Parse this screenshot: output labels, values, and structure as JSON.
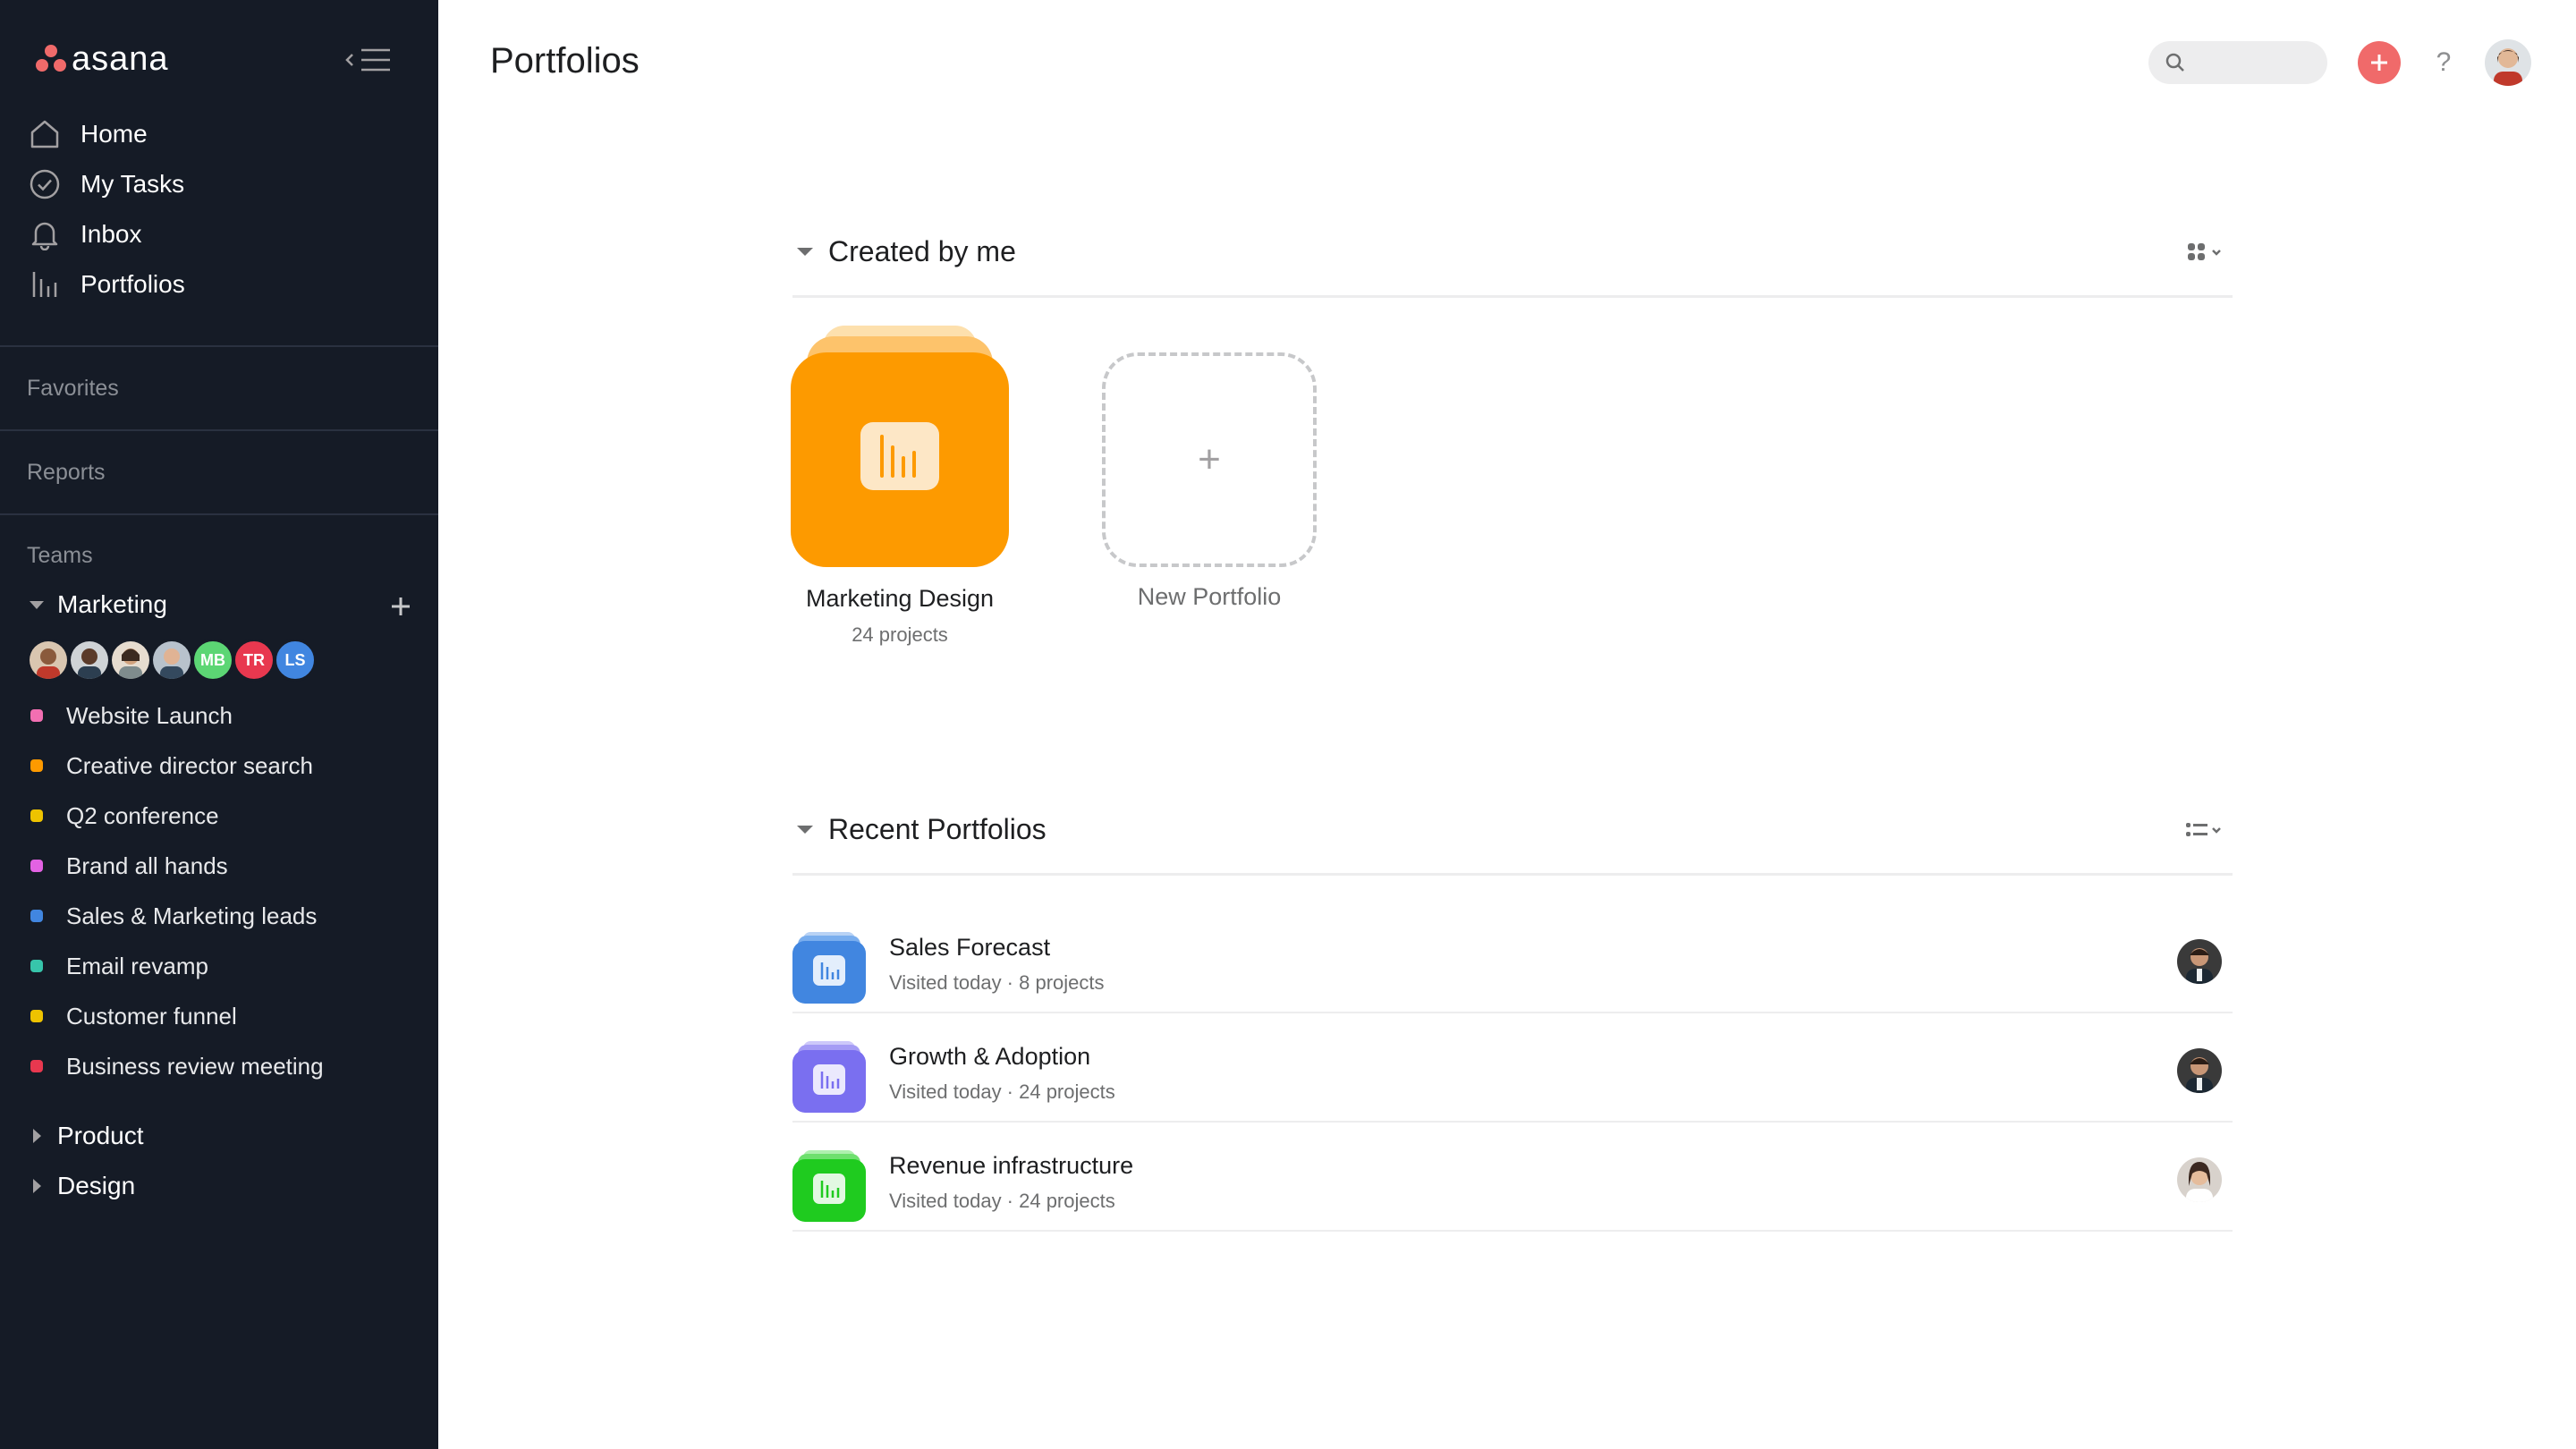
{
  "app": {
    "logo_text": "asana"
  },
  "sidebar": {
    "nav": [
      {
        "label": "Home",
        "icon": "home-icon"
      },
      {
        "label": "My Tasks",
        "icon": "check-circle-icon"
      },
      {
        "label": "Inbox",
        "icon": "bell-icon"
      },
      {
        "label": "Portfolios",
        "icon": "portfolio-bars-icon"
      }
    ],
    "favorites_label": "Favorites",
    "reports_label": "Reports",
    "teams_label": "Teams",
    "teams": [
      {
        "name": "Marketing",
        "expanded": true,
        "members": [
          {
            "type": "photo"
          },
          {
            "type": "photo"
          },
          {
            "type": "photo"
          },
          {
            "type": "photo"
          },
          {
            "type": "initials",
            "initials": "MB",
            "color": "#5cd674"
          },
          {
            "type": "initials",
            "initials": "TR",
            "color": "#e8384f"
          },
          {
            "type": "initials",
            "initials": "LS",
            "color": "#4186e0"
          }
        ],
        "projects": [
          {
            "name": "Website Launch",
            "color": "#f26fb2"
          },
          {
            "name": "Creative director search",
            "color": "#fd9a00"
          },
          {
            "name": "Q2 conference",
            "color": "#eec300"
          },
          {
            "name": "Brand all hands",
            "color": "#e362e3"
          },
          {
            "name": "Sales & Marketing leads",
            "color": "#4186e0"
          },
          {
            "name": "Email revamp",
            "color": "#37c5ab"
          },
          {
            "name": "Customer funnel",
            "color": "#eec300"
          },
          {
            "name": "Business review meeting",
            "color": "#e8384f"
          }
        ]
      },
      {
        "name": "Product",
        "expanded": false
      },
      {
        "name": "Design",
        "expanded": false
      }
    ]
  },
  "header": {
    "title": "Portfolios",
    "search_placeholder": "",
    "help_label": "?"
  },
  "created_by_me": {
    "title": "Created by me",
    "portfolios": [
      {
        "name": "Marketing Design",
        "subtitle": "24 projects",
        "color": "#fd9a00"
      }
    ],
    "new_portfolio_label": "New Portfolio",
    "new_portfolio_glyph": "+"
  },
  "recent": {
    "title": "Recent Portfolios",
    "items": [
      {
        "name": "Sales Forecast",
        "meta": "Visited today · 8 projects",
        "color": "#4186e0"
      },
      {
        "name": "Growth & Adoption",
        "meta": "Visited today · 24 projects",
        "color": "#7a6ff0"
      },
      {
        "name": "Revenue infrastructure",
        "meta": "Visited today · 24 projects",
        "color": "#1fcb1f"
      }
    ]
  }
}
